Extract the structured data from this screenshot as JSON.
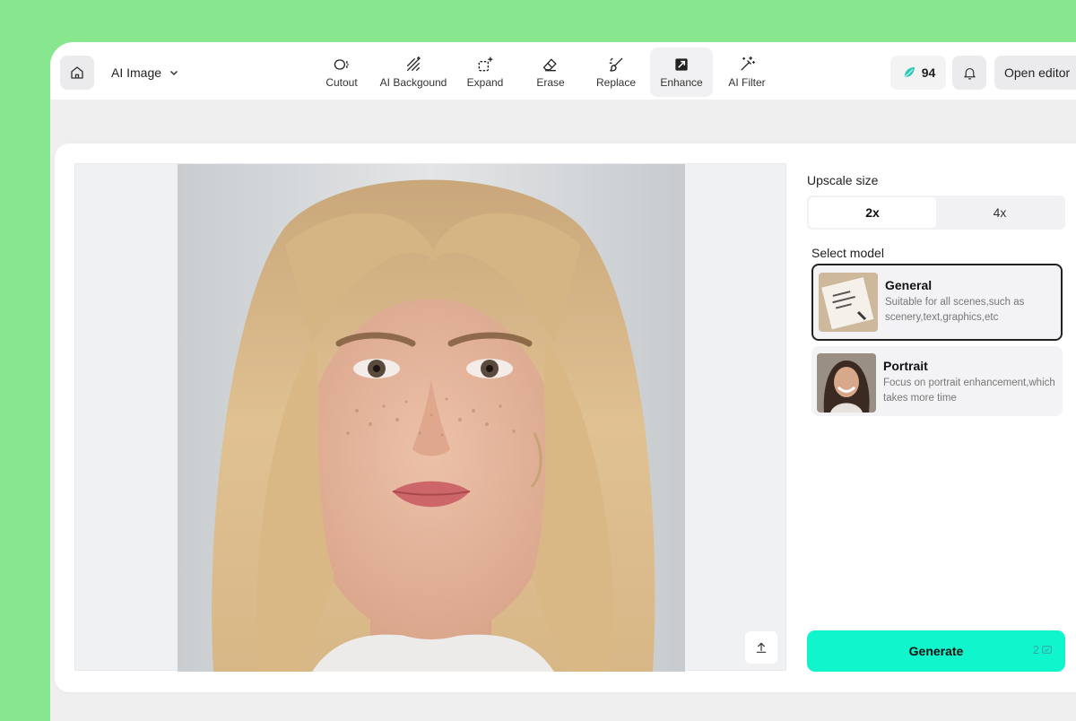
{
  "header": {
    "app_menu_label": "AI Image",
    "tools": [
      {
        "label": "Cutout",
        "icon": "cutout-icon"
      },
      {
        "label": "AI Backgound",
        "icon": "ai-background-icon"
      },
      {
        "label": "Expand",
        "icon": "expand-icon"
      },
      {
        "label": "Erase",
        "icon": "eraser-icon"
      },
      {
        "label": "Replace",
        "icon": "brush-icon"
      },
      {
        "label": "Enhance",
        "icon": "enhance-icon",
        "active": true
      },
      {
        "label": "AI Filter",
        "icon": "magic-wand-icon"
      }
    ],
    "credits": "94",
    "open_editor_label": "Open editor"
  },
  "sidebar": {
    "upscale_label": "Upscale size",
    "upscale_options": [
      "2x",
      "4x"
    ],
    "upscale_selected": "2x",
    "select_model_label": "Select model",
    "models": [
      {
        "name": "General",
        "description": "Suitable for all scenes,such as scenery,text,graphics,etc",
        "selected": true
      },
      {
        "name": "Portrait",
        "description": "Focus on portrait enhancement,which takes more time",
        "selected": false
      }
    ],
    "generate_label": "Generate",
    "generate_cost": "2"
  },
  "colors": {
    "page_bg": "#88e68f",
    "generate_bg": "#10f5cb",
    "credits_gem": "#2ec4b6"
  }
}
